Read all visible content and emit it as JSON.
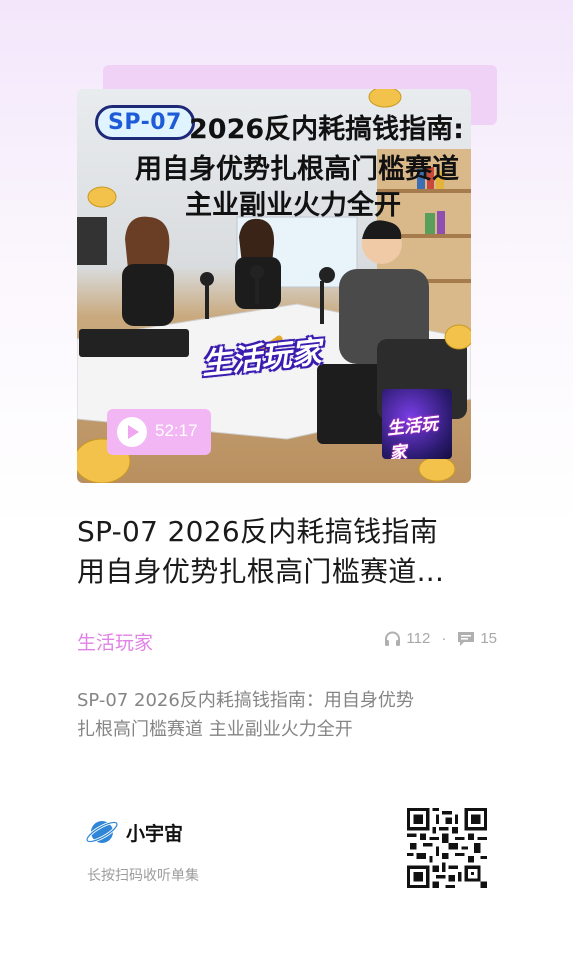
{
  "cover": {
    "code": "SP-07",
    "line1": "2026反内耗搞钱指南:",
    "line2": "用自身优势扎根高门槛赛道",
    "line3": "主业副业火力全开",
    "brand_sticker": "生活玩家",
    "mini_cover_text": "生活玩家",
    "duration": "52:17"
  },
  "episode": {
    "title_line1": "SP-07 2026反内耗搞钱指南",
    "title_line2": "用自身优势扎根高门槛赛道..."
  },
  "channel": {
    "name": "生活玩家"
  },
  "stats": {
    "listens": "112",
    "separator": "·",
    "comments": "15"
  },
  "description": {
    "line1": "SP-07 2026反内耗搞钱指南：用自身优势",
    "line2": "扎根高门槛赛道 主业副业火力全开"
  },
  "footer": {
    "app_name": "小宇宙",
    "hint": "长按扫码收听单集"
  },
  "colors": {
    "accent": "#e082e6",
    "play_chip": "#f3b6f4",
    "text": "#1a1a1a",
    "muted": "#858585"
  },
  "icons": [
    "play-icon",
    "headphones-icon",
    "comment-icon",
    "planet-logo-icon",
    "qr-code"
  ]
}
